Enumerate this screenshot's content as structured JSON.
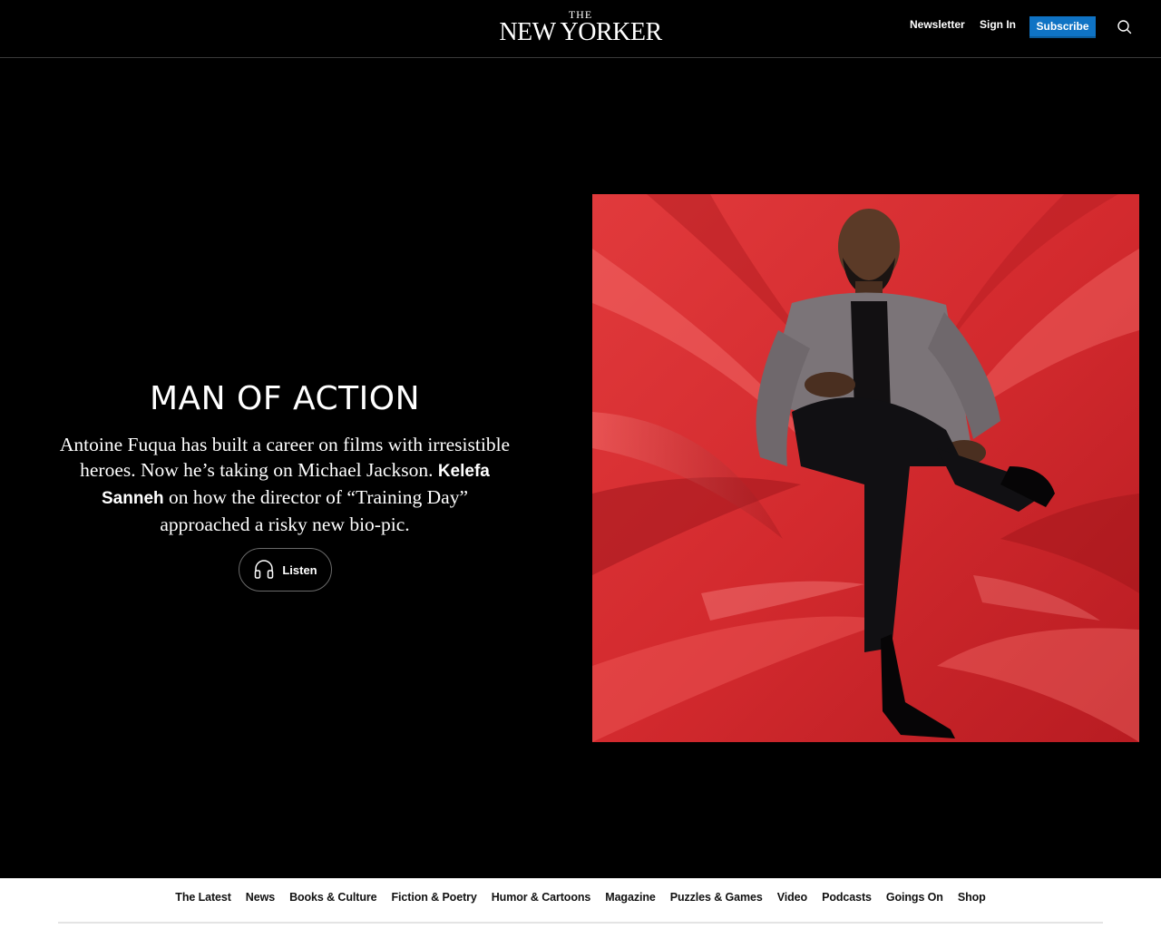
{
  "header": {
    "logo_the": "THE",
    "logo_name": "NEW YORKER",
    "newsletter": "Newsletter",
    "signin": "Sign In",
    "subscribe": "Subscribe",
    "search_icon": "search-icon",
    "accent_color": "#0f73c4"
  },
  "hero": {
    "title": "MAN OF ACTION",
    "dek_before": "Antoine Fuqua has built a career on films with irresistible heroes. Now he’s taking on Michael Jackson. ",
    "author": "Kelefa Sanneh",
    "dek_after": " on how the director of “Training Day” approached a risky new bio-pic.",
    "listen_label": "Listen",
    "listen_icon": "headphones-icon",
    "image_alt": "Antoine Fuqua seated on red satin fabric"
  },
  "bottom_nav": [
    "The Latest",
    "News",
    "Books & Culture",
    "Fiction & Poetry",
    "Humor & Cartoons",
    "Magazine",
    "Puzzles & Games",
    "Video",
    "Podcasts",
    "Goings On",
    "Shop"
  ]
}
